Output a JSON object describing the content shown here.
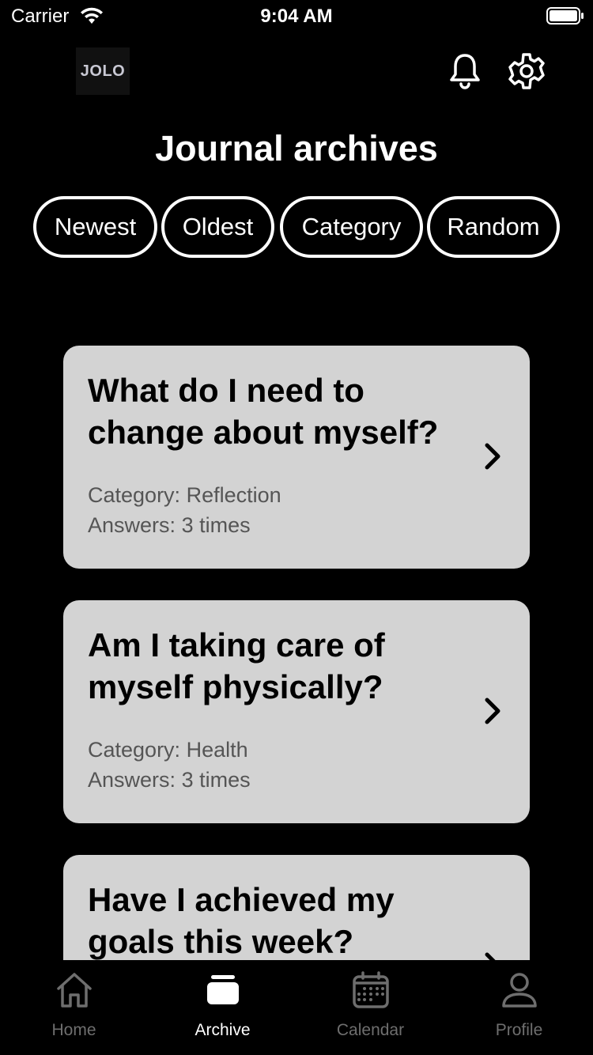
{
  "status_bar": {
    "carrier": "Carrier",
    "time": "9:04 AM"
  },
  "header": {
    "logo_text": "JOLO",
    "icons": [
      "bell-icon",
      "gear-icon"
    ]
  },
  "title": "Journal archives",
  "filters": [
    "Newest",
    "Oldest",
    "Category",
    "Random"
  ],
  "cards": [
    {
      "question": "What do I need to change about myself?",
      "category_label": "Category:",
      "category": "Reflection",
      "answers_label": "Answers:",
      "answers": "3 times"
    },
    {
      "question": "Am I taking care of myself physically?",
      "category_label": "Category:",
      "category": "Health",
      "answers_label": "Answers:",
      "answers": "3 times"
    },
    {
      "question": "Have I achieved my goals this week?",
      "category_label": "",
      "category": "",
      "answers_label": "",
      "answers": ""
    }
  ],
  "tabs": [
    {
      "label": "Home",
      "icon": "home-icon",
      "active": false
    },
    {
      "label": "Archive",
      "icon": "archive-icon",
      "active": true
    },
    {
      "label": "Calendar",
      "icon": "calendar-icon",
      "active": false
    },
    {
      "label": "Profile",
      "icon": "profile-icon",
      "active": false
    }
  ],
  "colors": {
    "background": "#000000",
    "card": "#d3d3d3",
    "inactive_tab": "#6e6e6e",
    "active_tab": "#ffffff"
  }
}
